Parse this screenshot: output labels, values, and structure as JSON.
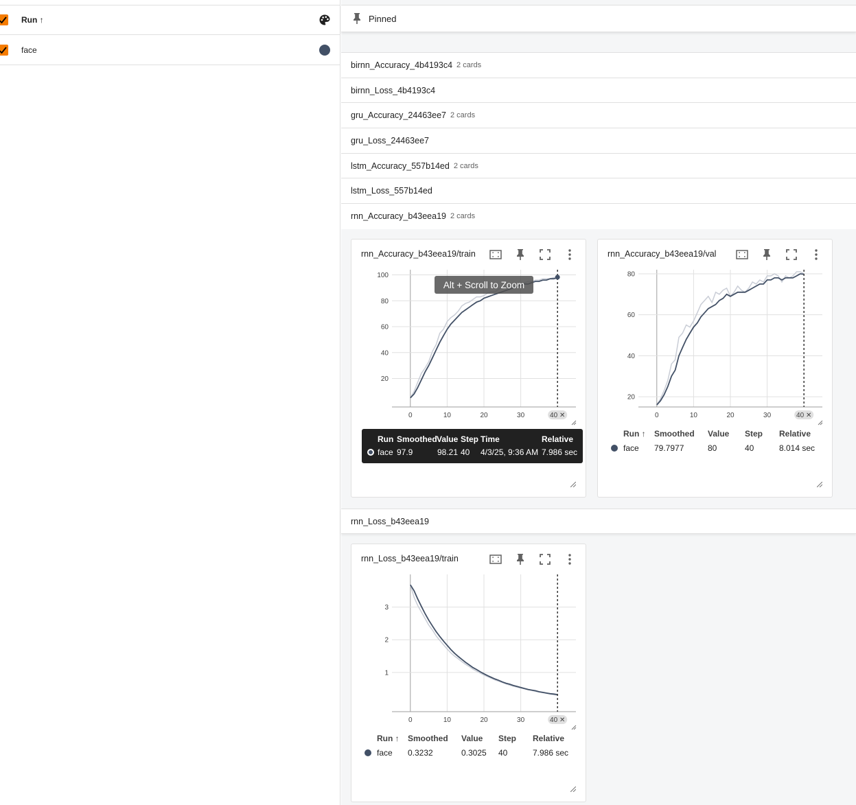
{
  "runs_panel": {
    "header_label": "Run ↑",
    "items": [
      {
        "label": "face",
        "color": "#425066"
      }
    ]
  },
  "pinned": {
    "label": "Pinned"
  },
  "groups": [
    {
      "name": "birnn_Accuracy_4b4193c4",
      "count": "2 cards"
    },
    {
      "name": "birnn_Loss_4b4193c4",
      "count": ""
    },
    {
      "name": "gru_Accuracy_24463ee7",
      "count": "2 cards"
    },
    {
      "name": "gru_Loss_24463ee7",
      "count": ""
    },
    {
      "name": "lstm_Accuracy_557b14ed",
      "count": "2 cards"
    },
    {
      "name": "lstm_Loss_557b14ed",
      "count": ""
    },
    {
      "name": "rnn_Accuracy_b43eea19",
      "count": "2 cards"
    }
  ],
  "loss_group": {
    "name": "rnn_Loss_b43eea19"
  },
  "cards": {
    "acc_train": {
      "title": "rnn_Accuracy_b43eea19/train",
      "zoom_hint": "Alt + Scroll to Zoom",
      "step_badge": "40 ✕",
      "tooltip": {
        "headers": {
          "run": "Run",
          "smoothed": "Smoothed",
          "value": "Value",
          "step": "Step",
          "time": "Time",
          "relative": "Relative"
        },
        "run": "face",
        "smoothed": "97.9",
        "value": "98.21",
        "step": "40",
        "time": "4/3/25, 9:36 AM",
        "relative": "7.986 sec"
      }
    },
    "acc_val": {
      "title": "rnn_Accuracy_b43eea19/val",
      "step_badge": "40 ✕",
      "table": {
        "headers": {
          "run": "Run ↑",
          "smoothed": "Smoothed",
          "value": "Value",
          "step": "Step",
          "relative": "Relative"
        },
        "run": "face",
        "smoothed": "79.7977",
        "value": "80",
        "step": "40",
        "relative": "8.014 sec"
      }
    },
    "loss_train": {
      "title": "rnn_Loss_b43eea19/train",
      "step_badge": "40 ✕",
      "table": {
        "headers": {
          "run": "Run ↑",
          "smoothed": "Smoothed",
          "value": "Value",
          "step": "Step",
          "relative": "Relative"
        },
        "run": "face",
        "smoothed": "0.3232",
        "value": "0.3025",
        "step": "40",
        "relative": "7.986 sec"
      }
    }
  },
  "chart_data": [
    {
      "type": "line",
      "title": "rnn_Accuracy_b43eea19/train",
      "xlabel": "",
      "ylabel": "",
      "xlim": [
        -5,
        45
      ],
      "ylim": [
        -2,
        104
      ],
      "xticks": [
        0,
        10,
        20,
        30
      ],
      "yticks": [
        20,
        40,
        60,
        80,
        100
      ],
      "x": [
        0,
        1,
        2,
        3,
        4,
        5,
        6,
        7,
        8,
        9,
        10,
        11,
        12,
        13,
        14,
        15,
        16,
        17,
        18,
        19,
        20,
        21,
        22,
        23,
        24,
        25,
        26,
        27,
        28,
        29,
        30,
        31,
        32,
        33,
        34,
        35,
        36,
        37,
        38,
        39,
        40
      ],
      "series": [
        {
          "name": "face",
          "role": "raw",
          "values": [
            5,
            10,
            17,
            24,
            28,
            33,
            41,
            46,
            55,
            58,
            64,
            67,
            69,
            72,
            76,
            78,
            79,
            81,
            83,
            83,
            84,
            86,
            87,
            87,
            89,
            90,
            90,
            91,
            92,
            93,
            93,
            94,
            95,
            95,
            96,
            96,
            97,
            97,
            97,
            98,
            98.21
          ]
        },
        {
          "name": "face",
          "role": "smoothed",
          "values": [
            5,
            8,
            13,
            19,
            25,
            30,
            36,
            42,
            48,
            53,
            58,
            62,
            65,
            68,
            71,
            73,
            75,
            77,
            79,
            80,
            82,
            83,
            84,
            85,
            86,
            87,
            88,
            89,
            90,
            91,
            92,
            93,
            93,
            94,
            95,
            95,
            96,
            96,
            97,
            97,
            97.9
          ]
        }
      ],
      "cursor_step": 40,
      "grid": true
    },
    {
      "type": "line",
      "title": "rnn_Accuracy_b43eea19/val",
      "xlabel": "",
      "ylabel": "",
      "xlim": [
        -5,
        45
      ],
      "ylim": [
        15,
        82
      ],
      "xticks": [
        0,
        10,
        20,
        30
      ],
      "yticks": [
        20,
        40,
        60,
        80
      ],
      "x": [
        0,
        1,
        2,
        3,
        4,
        5,
        6,
        7,
        8,
        9,
        10,
        11,
        12,
        13,
        14,
        15,
        16,
        17,
        18,
        19,
        20,
        21,
        22,
        23,
        24,
        25,
        26,
        27,
        28,
        29,
        30,
        31,
        32,
        33,
        34,
        35,
        36,
        37,
        38,
        39,
        40
      ],
      "series": [
        {
          "name": "face",
          "role": "raw",
          "values": [
            16,
            19,
            23,
            28,
            36,
            38,
            49,
            51,
            55,
            54,
            57,
            61,
            65,
            67,
            69,
            66,
            71,
            70,
            72,
            73,
            69,
            71,
            74,
            72,
            71,
            73,
            76,
            75,
            77,
            76,
            79,
            79,
            80,
            79,
            76,
            79,
            78,
            79,
            81,
            81,
            80
          ]
        },
        {
          "name": "face",
          "role": "smoothed",
          "values": [
            16,
            18,
            21,
            25,
            30,
            33,
            40,
            44,
            48,
            51,
            54,
            56,
            59,
            61,
            63,
            64,
            65,
            67,
            68,
            70,
            69,
            70,
            71,
            71,
            71,
            72,
            73,
            74,
            75,
            75,
            77,
            77,
            78,
            78,
            77,
            78,
            78,
            78,
            79,
            80,
            79.7977
          ]
        }
      ],
      "cursor_step": 40,
      "grid": true
    },
    {
      "type": "line",
      "title": "rnn_Loss_b43eea19/train",
      "xlabel": "",
      "ylabel": "",
      "xlim": [
        -5,
        45
      ],
      "ylim": [
        -0.2,
        4.0
      ],
      "xticks": [
        0,
        10,
        20,
        30
      ],
      "yticks": [
        1,
        2,
        3
      ],
      "x": [
        0,
        1,
        2,
        3,
        4,
        5,
        6,
        7,
        8,
        9,
        10,
        11,
        12,
        13,
        14,
        15,
        16,
        17,
        18,
        19,
        20,
        21,
        22,
        23,
        24,
        25,
        26,
        27,
        28,
        29,
        30,
        31,
        32,
        33,
        34,
        35,
        36,
        37,
        38,
        39,
        40
      ],
      "series": [
        {
          "name": "face",
          "role": "raw",
          "values": [
            3.68,
            3.3,
            3.05,
            2.85,
            2.65,
            2.45,
            2.3,
            2.12,
            1.98,
            1.85,
            1.72,
            1.6,
            1.5,
            1.42,
            1.33,
            1.25,
            1.18,
            1.1,
            1.04,
            0.98,
            0.92,
            0.87,
            0.82,
            0.77,
            0.73,
            0.69,
            0.65,
            0.61,
            0.58,
            0.55,
            0.52,
            0.5,
            0.47,
            0.45,
            0.42,
            0.4,
            0.38,
            0.36,
            0.34,
            0.32,
            0.3025
          ]
        },
        {
          "name": "face",
          "role": "smoothed",
          "values": [
            3.68,
            3.5,
            3.25,
            3.02,
            2.8,
            2.6,
            2.42,
            2.25,
            2.1,
            1.96,
            1.83,
            1.7,
            1.59,
            1.49,
            1.4,
            1.31,
            1.23,
            1.15,
            1.09,
            1.02,
            0.96,
            0.9,
            0.85,
            0.8,
            0.76,
            0.71,
            0.67,
            0.64,
            0.6,
            0.57,
            0.54,
            0.51,
            0.48,
            0.46,
            0.44,
            0.41,
            0.39,
            0.37,
            0.35,
            0.34,
            0.3232
          ]
        }
      ],
      "cursor_step": 40,
      "grid": true
    }
  ]
}
